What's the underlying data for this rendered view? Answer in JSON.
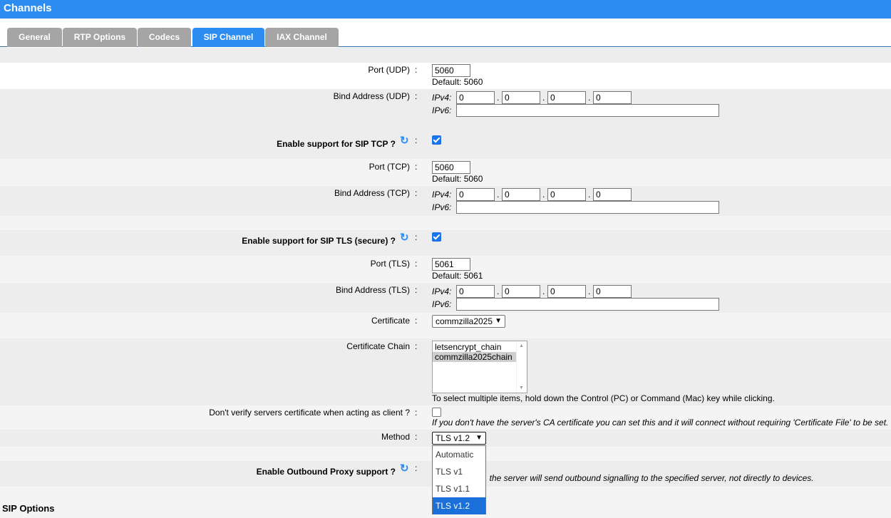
{
  "header": {
    "title": "Channels"
  },
  "tabs": [
    {
      "label": "General"
    },
    {
      "label": "RTP Options"
    },
    {
      "label": "Codecs"
    },
    {
      "label": "SIP Channel"
    },
    {
      "label": "IAX Channel"
    }
  ],
  "udp": {
    "port_label": "Port (UDP)",
    "port_value": "5060",
    "port_default": "Default: 5060",
    "bind_label": "Bind Address (UDP)",
    "ipv4_label": "IPv4:",
    "ipv6_label": "IPv6:",
    "ipv4": [
      "0",
      "0",
      "0",
      "0"
    ],
    "ipv6": ""
  },
  "tcp": {
    "enable_label": "Enable support for SIP TCP ?",
    "enabled": true,
    "port_label": "Port (TCP)",
    "port_value": "5060",
    "port_default": "Default: 5060",
    "bind_label": "Bind Address (TCP)",
    "ipv4_label": "IPv4:",
    "ipv6_label": "IPv6:",
    "ipv4": [
      "0",
      "0",
      "0",
      "0"
    ],
    "ipv6": ""
  },
  "tls": {
    "enable_label": "Enable support for SIP TLS (secure) ?",
    "enabled": true,
    "port_label": "Port (TLS)",
    "port_value": "5061",
    "port_default": "Default: 5061",
    "bind_label": "Bind Address (TLS)",
    "ipv4_label": "IPv4:",
    "ipv6_label": "IPv6:",
    "ipv4": [
      "0",
      "0",
      "0",
      "0"
    ],
    "ipv6": "",
    "certificate_label": "Certificate",
    "certificate_value": "commzilla2025",
    "chain_label": "Certificate Chain",
    "chain_options": [
      "letsencrypt_chain",
      "commzilla2025chain"
    ],
    "chain_selected": "commzilla2025chain",
    "chain_help": "To select multiple items, hold down the Control (PC) or Command (Mac) key while clicking.",
    "dont_verify_label": "Don't verify servers certificate when acting as client ?",
    "dont_verify_checked": false,
    "dont_verify_help": "If you don't have the server's CA certificate you can set this and it will connect without requiring 'Certificate File' to be set.",
    "method_label": "Method",
    "method_value": "TLS v1.2",
    "method_options": [
      "Automatic",
      "TLS v1",
      "TLS v1.1",
      "TLS v1.2"
    ]
  },
  "outbound_proxy": {
    "enable_label": "Enable Outbound Proxy support ?",
    "help_visible": ", the server will send outbound signalling to the specified server, not directly to devices."
  },
  "section_title": "SIP Options",
  "colon": ":",
  "dot": ".",
  "icons": {
    "refresh": "refresh-icon"
  },
  "colors": {
    "accent": "#2d8cf0",
    "tab_inactive": "#a5a5a5",
    "row_grey": "#ededed",
    "highlight": "#1a6fd8"
  }
}
